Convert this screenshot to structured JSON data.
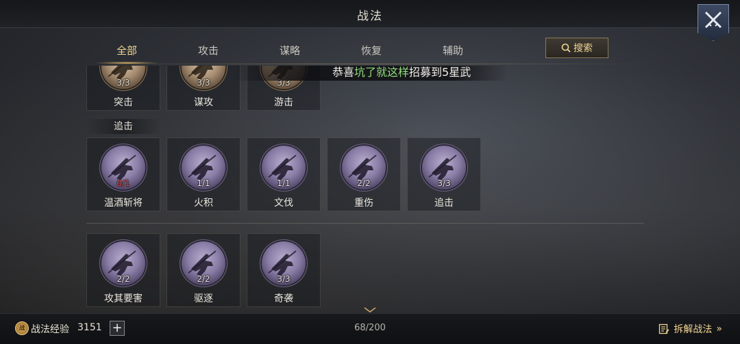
{
  "header": {
    "title": "战法"
  },
  "tabs": [
    {
      "label": "全部",
      "active": true
    },
    {
      "label": "攻击",
      "active": false
    },
    {
      "label": "谋略",
      "active": false
    },
    {
      "label": "恢复",
      "active": false
    },
    {
      "label": "辅助",
      "active": false
    }
  ],
  "search": {
    "label": "搜索"
  },
  "banner": {
    "prefix": "恭喜",
    "player": "坑了就这样",
    "suffix": "招募到5星武"
  },
  "top_row": [
    {
      "name": "突击",
      "count": "3/3"
    },
    {
      "name": "谋攻",
      "count": "3/3"
    },
    {
      "name": "游击",
      "count": "3/3"
    }
  ],
  "section": {
    "label": "追击"
  },
  "row2": [
    {
      "name": "温酒斩将",
      "count": "0/1"
    },
    {
      "name": "火积",
      "count": "1/1"
    },
    {
      "name": "文伐",
      "count": "1/1"
    },
    {
      "name": "重伤",
      "count": "2/2"
    },
    {
      "name": "追击",
      "count": "3/3"
    }
  ],
  "row3": [
    {
      "name": "攻其要害",
      "count": "2/2"
    },
    {
      "name": "驱逐",
      "count": "2/2"
    },
    {
      "name": "奇袭",
      "count": "3/3"
    }
  ],
  "footer": {
    "exp_icon": "战",
    "exp_label": "战法经验",
    "exp_value": "3151",
    "plus": "+",
    "page_count": "68/200",
    "decompose_label": "拆解战法",
    "decompose_arrow": "»"
  },
  "colors": {
    "accent": "#f1d694",
    "highlight": "#8fdd7a",
    "count_empty": "#d8463f"
  }
}
